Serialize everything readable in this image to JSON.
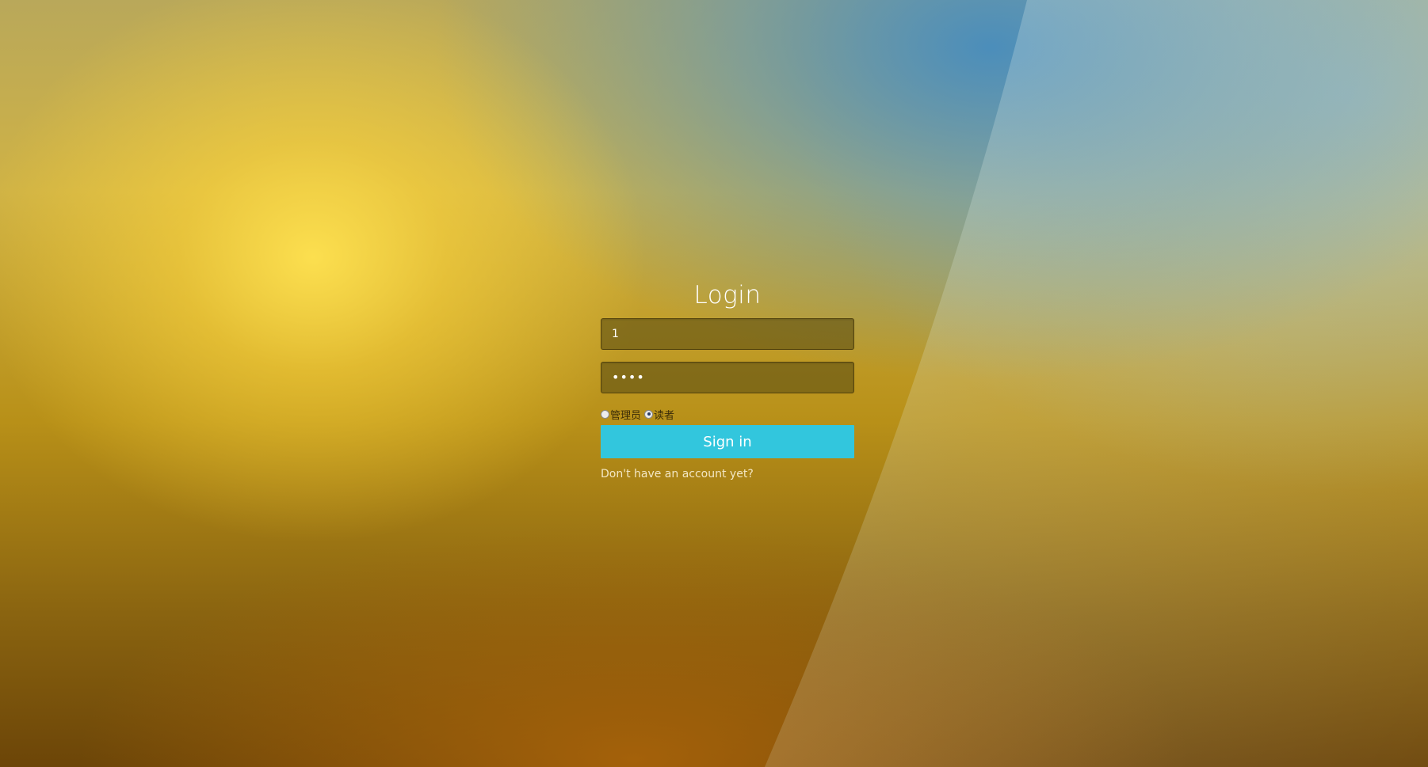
{
  "login": {
    "title": "Login",
    "username_value": "1",
    "password_value": "••••",
    "roles": [
      {
        "label": "管理员",
        "checked": false
      },
      {
        "label": "读者",
        "checked": true
      }
    ],
    "signin_label": "Sign in",
    "register_link": "Don't have an account yet?"
  },
  "colors": {
    "signin_button": "#32c6dd",
    "field_background": "#5f5014"
  }
}
